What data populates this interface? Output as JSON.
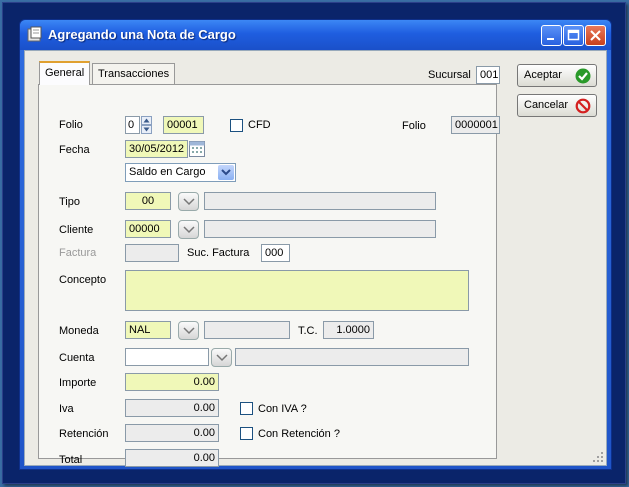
{
  "window": {
    "title": "Agregando una Nota de Cargo"
  },
  "tabs": [
    {
      "label": "General"
    },
    {
      "label": "Transacciones"
    }
  ],
  "sucursal": {
    "label": "Sucursal",
    "value": "001"
  },
  "actions": {
    "accept_label": "Aceptar",
    "cancel_label": "Cancelar"
  },
  "form": {
    "folio": {
      "label": "Folio",
      "series": "0",
      "number": "00001"
    },
    "cfd": {
      "label": "CFD",
      "checked": false
    },
    "folio2": {
      "label": "Folio",
      "value": "0000001"
    },
    "fecha": {
      "label": "Fecha",
      "value": "30/05/2012"
    },
    "saldo": {
      "value": "Saldo en Cargo"
    },
    "tipo": {
      "label": "Tipo",
      "code": "00",
      "desc": ""
    },
    "cliente": {
      "label": "Cliente",
      "code": "00000",
      "desc": ""
    },
    "factura": {
      "label": "Factura",
      "value": "",
      "suc_label": "Suc. Factura",
      "suc_value": "000"
    },
    "concepto": {
      "label": "Concepto",
      "value": ""
    },
    "moneda": {
      "label": "Moneda",
      "code": "NAL",
      "desc": "",
      "tc_label": "T.C.",
      "tc_value": "1.0000"
    },
    "cuenta": {
      "label": "Cuenta",
      "code": "",
      "desc": ""
    },
    "importe": {
      "label": "Importe",
      "value": "0.00"
    },
    "iva": {
      "label": "Iva",
      "value": "0.00",
      "chk_label": "Con IVA ?"
    },
    "retencion": {
      "label": "Retención",
      "value": "0.00",
      "chk_label": "Con Retención ?"
    },
    "total": {
      "label": "Total",
      "value": "0.00"
    }
  },
  "colors": {
    "required_field": "#f0f8b8",
    "title_bar": "#1f5ee0",
    "client_bg": "#ecebe5"
  }
}
